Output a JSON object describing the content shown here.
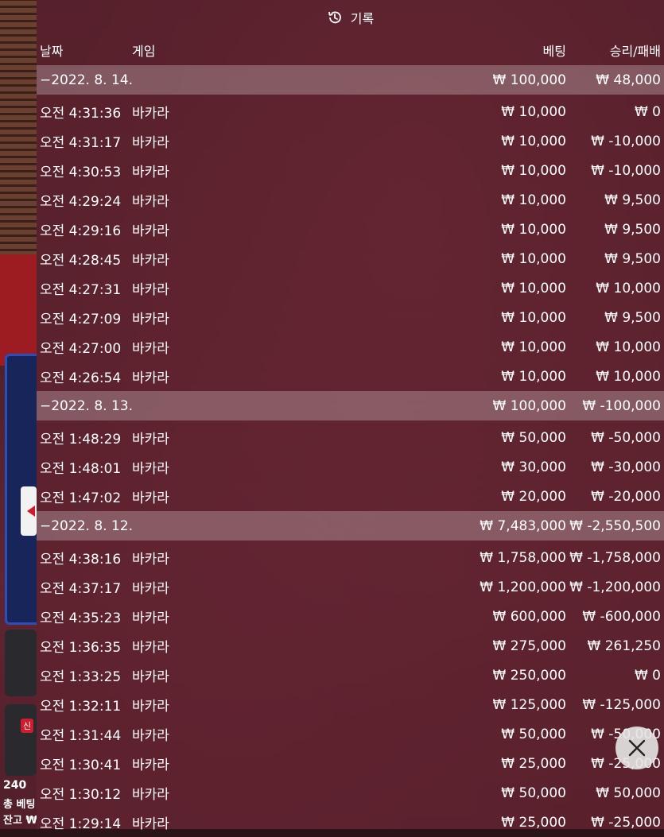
{
  "header": {
    "title": "기록"
  },
  "columns": {
    "date": "날짜",
    "game": "게임",
    "bet": "베팅",
    "winloss": "승리/패배"
  },
  "groups": [
    {
      "date": "−2022. 8. 14.",
      "bet": "₩ 100,000",
      "winloss": "₩ 48,000",
      "rows": [
        {
          "time": "오전 4:31:36",
          "game": "바카라",
          "bet": "₩ 10,000",
          "winloss": "₩ 0"
        },
        {
          "time": "오전 4:31:17",
          "game": "바카라",
          "bet": "₩ 10,000",
          "winloss": "₩ -10,000"
        },
        {
          "time": "오전 4:30:53",
          "game": "바카라",
          "bet": "₩ 10,000",
          "winloss": "₩ -10,000"
        },
        {
          "time": "오전 4:29:24",
          "game": "바카라",
          "bet": "₩ 10,000",
          "winloss": "₩ 9,500"
        },
        {
          "time": "오전 4:29:16",
          "game": "바카라",
          "bet": "₩ 10,000",
          "winloss": "₩ 9,500"
        },
        {
          "time": "오전 4:28:45",
          "game": "바카라",
          "bet": "₩ 10,000",
          "winloss": "₩ 9,500"
        },
        {
          "time": "오전 4:27:31",
          "game": "바카라",
          "bet": "₩ 10,000",
          "winloss": "₩ 10,000"
        },
        {
          "time": "오전 4:27:09",
          "game": "바카라",
          "bet": "₩ 10,000",
          "winloss": "₩ 9,500"
        },
        {
          "time": "오전 4:27:00",
          "game": "바카라",
          "bet": "₩ 10,000",
          "winloss": "₩ 10,000"
        },
        {
          "time": "오전 4:26:54",
          "game": "바카라",
          "bet": "₩ 10,000",
          "winloss": "₩ 10,000"
        }
      ]
    },
    {
      "date": "−2022. 8. 13.",
      "bet": "₩ 100,000",
      "winloss": "₩ -100,000",
      "rows": [
        {
          "time": "오전 1:48:29",
          "game": "바카라",
          "bet": "₩ 50,000",
          "winloss": "₩ -50,000"
        },
        {
          "time": "오전 1:48:01",
          "game": "바카라",
          "bet": "₩ 30,000",
          "winloss": "₩ -30,000"
        },
        {
          "time": "오전 1:47:02",
          "game": "바카라",
          "bet": "₩ 20,000",
          "winloss": "₩ -20,000"
        }
      ]
    },
    {
      "date": "−2022. 8. 12.",
      "bet": "₩ 7,483,000",
      "winloss": "₩ -2,550,500",
      "rows": [
        {
          "time": "오전 4:38:16",
          "game": "바카라",
          "bet": "₩ 1,758,000",
          "winloss": "₩ -1,758,000"
        },
        {
          "time": "오전 4:37:17",
          "game": "바카라",
          "bet": "₩ 1,200,000",
          "winloss": "₩ -1,200,000"
        },
        {
          "time": "오전 4:35:23",
          "game": "바카라",
          "bet": "₩ 600,000",
          "winloss": "₩ -600,000"
        },
        {
          "time": "오전 1:36:35",
          "game": "바카라",
          "bet": "₩ 275,000",
          "winloss": "₩ 261,250"
        },
        {
          "time": "오전 1:33:25",
          "game": "바카라",
          "bet": "₩ 250,000",
          "winloss": "₩ 0"
        },
        {
          "time": "오전 1:32:11",
          "game": "바카라",
          "bet": "₩ 125,000",
          "winloss": "₩ -125,000"
        },
        {
          "time": "오전 1:31:44",
          "game": "바카라",
          "bet": "₩ 50,000",
          "winloss": "₩ -50,000"
        },
        {
          "time": "오전 1:30:41",
          "game": "바카라",
          "bet": "₩ 25,000",
          "winloss": "₩ -25,000"
        },
        {
          "time": "오전 1:30:12",
          "game": "바카라",
          "bet": "₩ 50,000",
          "winloss": "₩ 50,000"
        },
        {
          "time": "오전 1:29:14",
          "game": "바카라",
          "bet": "₩ 25,000",
          "winloss": "₩ -25,000"
        }
      ]
    }
  ],
  "side": {
    "badge": "신",
    "count": "240",
    "total_bet": "총 베팅",
    "balance": "잔고 ₩"
  },
  "icons": {
    "history": "history-icon",
    "close": "close-icon"
  }
}
